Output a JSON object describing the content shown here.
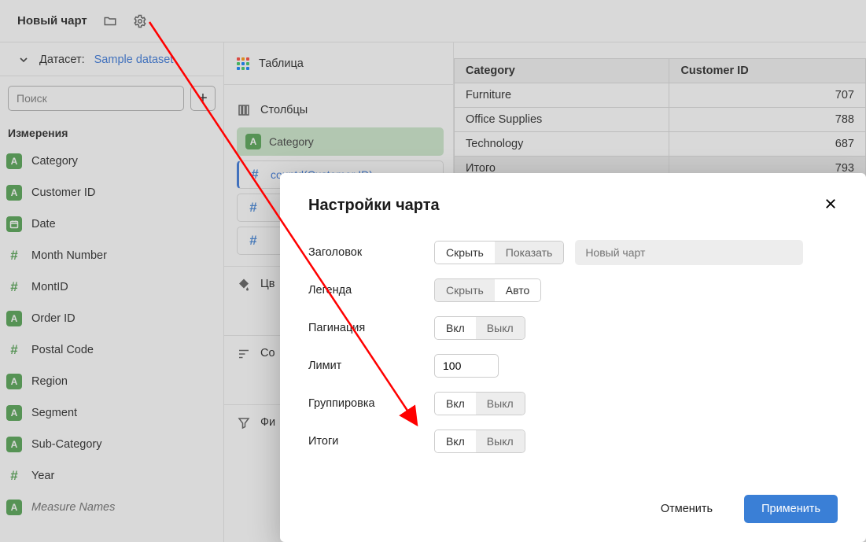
{
  "topbar": {
    "title": "Новый чарт"
  },
  "dataset": {
    "label": "Датасет:",
    "link": "Sample dataset"
  },
  "search": {
    "placeholder": "Поиск"
  },
  "dimensionsTitle": "Измерения",
  "fields": [
    {
      "type": "A",
      "label": "Category"
    },
    {
      "type": "A",
      "label": "Customer ID"
    },
    {
      "type": "date",
      "label": "Date"
    },
    {
      "type": "hash",
      "label": "Month Number"
    },
    {
      "type": "hash",
      "label": "MontID"
    },
    {
      "type": "A",
      "label": "Order ID"
    },
    {
      "type": "hash",
      "label": "Postal Code"
    },
    {
      "type": "A",
      "label": "Region"
    },
    {
      "type": "A",
      "label": "Segment"
    },
    {
      "type": "A",
      "label": "Sub-Category"
    },
    {
      "type": "hash",
      "label": "Year"
    },
    {
      "type": "A",
      "label": "Measure Names",
      "italic": true
    }
  ],
  "mid": {
    "vizType": "Таблица",
    "columnsLabel": "Столбцы",
    "columns": [
      {
        "kind": "green",
        "icon": "A",
        "label": "Category"
      },
      {
        "kind": "active",
        "icon": "hash-blue",
        "label": "countd(Customer ID)"
      },
      {
        "kind": "white",
        "icon": "hash-blue",
        "label": ""
      },
      {
        "kind": "white",
        "icon": "hash-blue",
        "label": ""
      }
    ],
    "colorsLabel": "Цв",
    "sortLabel": "Со",
    "filterLabel": "Фи"
  },
  "table": {
    "headers": [
      "Category",
      "Customer ID"
    ],
    "rows": [
      {
        "c": "Furniture",
        "v": "707"
      },
      {
        "c": "Office Supplies",
        "v": "788"
      },
      {
        "c": "Technology",
        "v": "687"
      }
    ],
    "total": {
      "c": "Итого",
      "v": "793"
    }
  },
  "dialog": {
    "title": "Настройки чарта",
    "rows": {
      "header": {
        "label": "Заголовок",
        "opt1": "Скрыть",
        "opt2": "Показать",
        "active": 1,
        "input_ph": "Новый чарт"
      },
      "legend": {
        "label": "Легенда",
        "opt1": "Скрыть",
        "opt2": "Авто",
        "active": 2
      },
      "pagination": {
        "label": "Пагинация",
        "opt1": "Вкл",
        "opt2": "Выкл",
        "active": 1
      },
      "limit": {
        "label": "Лимит",
        "value": "100"
      },
      "grouping": {
        "label": "Группировка",
        "opt1": "Вкл",
        "opt2": "Выкл",
        "active": 1
      },
      "totals": {
        "label": "Итоги",
        "opt1": "Вкл",
        "opt2": "Выкл",
        "active": 1
      }
    },
    "cancel": "Отменить",
    "apply": "Применить"
  }
}
